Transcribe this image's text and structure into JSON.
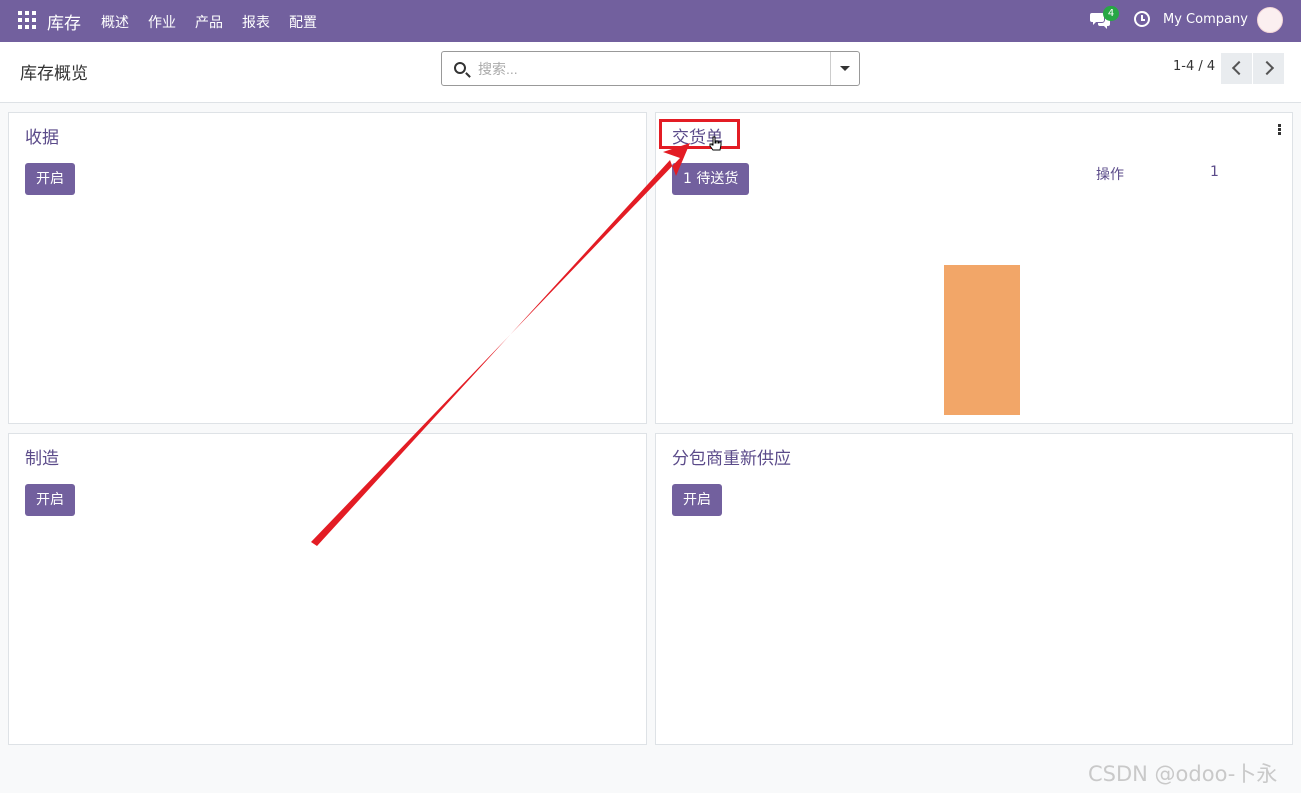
{
  "navbar": {
    "brand": "库存",
    "menu": [
      "概述",
      "作业",
      "产品",
      "报表",
      "配置"
    ],
    "chat_badge": "4",
    "company": "My Company",
    "color": "#72609e"
  },
  "control_panel": {
    "title": "库存概览",
    "search_placeholder": "搜索...",
    "pager_value": "1-4 / 4"
  },
  "cards": [
    {
      "title": "收据",
      "button": "开启"
    },
    {
      "title": "交货单",
      "button": "1 待送货",
      "op_label": "操作",
      "op_value": "1",
      "graph": {
        "bar_color": "#f2a668",
        "values": [
          1
        ]
      }
    },
    {
      "title": "制造",
      "button": "开启"
    },
    {
      "title": "分包商重新供应",
      "button": "开启"
    }
  ],
  "annotation": {
    "highlight_color": "#e31c24"
  },
  "watermark": "CSDN @odoo-卜永"
}
